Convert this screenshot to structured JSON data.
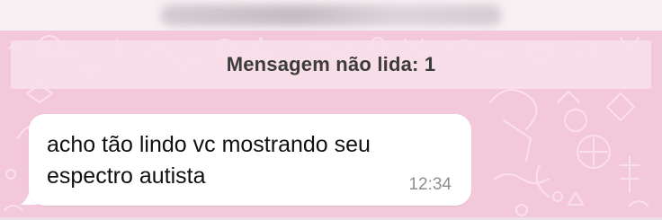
{
  "header": {
    "blurred": true
  },
  "unread_banner": {
    "label": "Mensagem não lida: 1"
  },
  "message": {
    "text": "acho tão lindo vc mostrando seu espectro autista",
    "time": "12:34"
  },
  "colors": {
    "wallpaper": "#f3c8da",
    "doodle": "#fbe3ec",
    "banner": "#f8e0ea",
    "bubble": "#ffffff",
    "time": "#8e8e93"
  }
}
